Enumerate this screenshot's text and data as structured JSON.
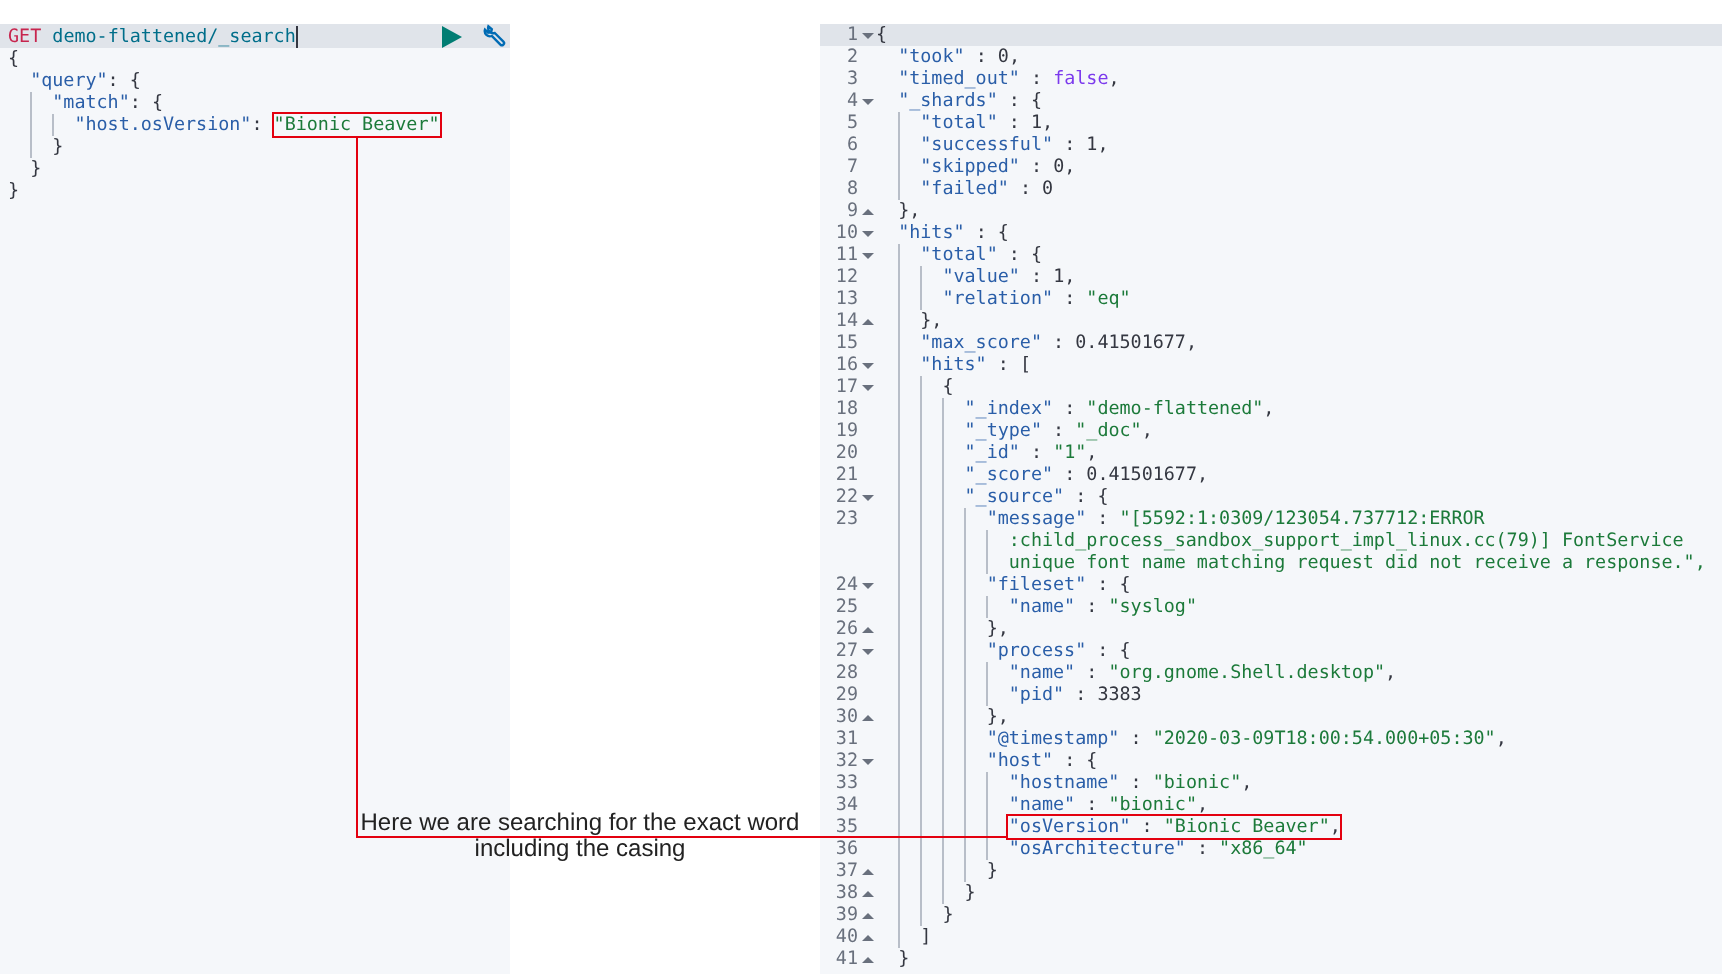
{
  "request": {
    "method": "GET",
    "path": "demo-flattened/_search",
    "lines": [
      {
        "code": "{"
      },
      {
        "code": "  \"query\": {"
      },
      {
        "code": "    \"match\": {"
      },
      {
        "code": "      \"host.osVersion\": ",
        "boxed": "\"Bionic Beaver\""
      },
      {
        "code": "    }"
      },
      {
        "code": "  }"
      },
      {
        "code": "}"
      }
    ]
  },
  "response": {
    "lines": [
      {
        "n": "1",
        "code": "{",
        "kind": "fold-start",
        "active": true
      },
      {
        "n": "2",
        "code": "  \"took\" : 0,",
        "kind": "plain",
        "active": false
      },
      {
        "n": "3",
        "code": "  \"timed_out\" : false,",
        "kind": "plain",
        "active": false
      },
      {
        "n": "4",
        "code": "  \"_shards\" : {",
        "kind": "fold-start",
        "active": false
      },
      {
        "n": "5",
        "code": "    \"total\" : 1,",
        "kind": "plain",
        "active": false
      },
      {
        "n": "6",
        "code": "    \"successful\" : 1,",
        "kind": "plain",
        "active": false
      },
      {
        "n": "7",
        "code": "    \"skipped\" : 0,",
        "kind": "plain",
        "active": false
      },
      {
        "n": "8",
        "code": "    \"failed\" : 0",
        "kind": "plain",
        "active": false
      },
      {
        "n": "9",
        "code": "  },",
        "kind": "fold-end",
        "active": false
      },
      {
        "n": "10",
        "code": "  \"hits\" : {",
        "kind": "fold-start",
        "active": false
      },
      {
        "n": "11",
        "code": "    \"total\" : {",
        "kind": "fold-start",
        "active": false
      },
      {
        "n": "12",
        "code": "      \"value\" : 1,",
        "kind": "plain",
        "active": false
      },
      {
        "n": "13",
        "code": "      \"relation\" : \"eq\"",
        "kind": "plain",
        "active": false
      },
      {
        "n": "14",
        "code": "    },",
        "kind": "fold-end",
        "active": false
      },
      {
        "n": "15",
        "code": "    \"max_score\" : 0.41501677,",
        "kind": "plain",
        "active": false
      },
      {
        "n": "16",
        "code": "    \"hits\" : [",
        "kind": "fold-start",
        "active": false
      },
      {
        "n": "17",
        "code": "      {",
        "kind": "fold-start",
        "active": false
      },
      {
        "n": "18",
        "code": "        \"_index\" : \"demo-flattened\",",
        "kind": "plain",
        "active": false
      },
      {
        "n": "19",
        "code": "        \"_type\" : \"_doc\",",
        "kind": "plain",
        "active": false
      },
      {
        "n": "20",
        "code": "        \"_id\" : \"1\",",
        "kind": "plain",
        "active": false
      },
      {
        "n": "21",
        "code": "        \"_score\" : 0.41501677,",
        "kind": "plain",
        "active": false
      },
      {
        "n": "22",
        "code": "        \"_source\" : {",
        "kind": "fold-start",
        "active": false
      },
      {
        "n": "23",
        "code": "          \"message\" : \"[5592:1:0309/123054.737712:ERROR",
        "wrapped": [
          ":child_process_sandbox_support_impl_linux.cc(79)] FontService",
          "unique font name matching request did not receive a response.\","
        ],
        "kind": "plain",
        "active": false
      },
      {
        "n": "24",
        "code": "          \"fileset\" : {",
        "kind": "fold-start",
        "active": false
      },
      {
        "n": "25",
        "code": "            \"name\" : \"syslog\"",
        "kind": "plain",
        "active": false
      },
      {
        "n": "26",
        "code": "          },",
        "kind": "fold-end",
        "active": false
      },
      {
        "n": "27",
        "code": "          \"process\" : {",
        "kind": "fold-start",
        "active": false
      },
      {
        "n": "28",
        "code": "            \"name\" : \"org.gnome.Shell.desktop\",",
        "kind": "plain",
        "active": false
      },
      {
        "n": "29",
        "code": "            \"pid\" : 3383",
        "kind": "plain",
        "active": false
      },
      {
        "n": "30",
        "code": "          },",
        "kind": "fold-end",
        "active": false
      },
      {
        "n": "31",
        "code": "          \"@timestamp\" : \"2020-03-09T18:00:54.000+05:30\",",
        "kind": "plain",
        "active": false
      },
      {
        "n": "32",
        "code": "          \"host\" : {",
        "kind": "fold-start",
        "active": false
      },
      {
        "n": "33",
        "code": "            \"hostname\" : \"bionic\",",
        "kind": "plain",
        "active": false
      },
      {
        "n": "34",
        "code": "            \"name\" : \"bionic\",",
        "kind": "plain",
        "active": false
      },
      {
        "n": "35",
        "boxed": "            \"osVersion\" : \"Bionic Beaver\",",
        "kind": "plain",
        "active": false
      },
      {
        "n": "36",
        "code": "            \"osArchitecture\" : \"x86_64\"",
        "kind": "plain",
        "active": false
      },
      {
        "n": "37",
        "code": "          }",
        "kind": "fold-end",
        "active": false
      },
      {
        "n": "38",
        "code": "        }",
        "kind": "fold-end",
        "active": false
      },
      {
        "n": "39",
        "code": "      }",
        "kind": "fold-end",
        "active": false
      },
      {
        "n": "40",
        "code": "    ]",
        "kind": "fold-end",
        "active": false
      },
      {
        "n": "41",
        "code": "  }",
        "kind": "fold-end",
        "active": false
      }
    ]
  },
  "annotation": {
    "caption": "Here we are searching for the exact word including the casing"
  }
}
